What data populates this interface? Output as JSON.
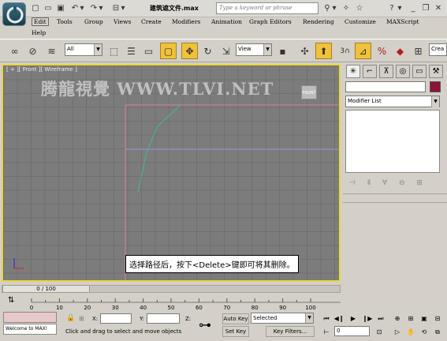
{
  "titlebar": {
    "file_title": "建筑遮文件.max",
    "search_placeholder": "Type a keyword or phrase"
  },
  "menu": [
    "Edit",
    "Tools",
    "Group",
    "Views",
    "Create",
    "Modifiers",
    "Animation",
    "Graph Editors",
    "Rendering",
    "Customize",
    "MAXScript",
    "Help"
  ],
  "toolbar": {
    "selection_filter": "All",
    "coord_system": "View",
    "snap_label": "3",
    "named_set_placeholder": "Crea"
  },
  "viewport": {
    "label": "[ + ][ Front ][ Wireframe ]",
    "watermark": "腾龍視覺 WWW.TLVI.NET",
    "front_gizmo": "FRONT",
    "caption": "选择路径后，按下<Delete>键即可将其删除。"
  },
  "command_panel": {
    "modifier_list": "Modifier List",
    "object_color": "#8b1538"
  },
  "timeline": {
    "frame_readout": "0 / 100",
    "ticks": [
      "0",
      "10",
      "20",
      "30",
      "40",
      "50",
      "60",
      "70",
      "80",
      "90",
      "100"
    ]
  },
  "status": {
    "maxscript_listener": "Welcome to MAX!",
    "x_label": "X:",
    "y_label": "Y:",
    "z_label": "Z:",
    "prompt": "Click and drag to select and move objects",
    "auto_key": "Auto Key",
    "set_key": "Set Key",
    "key_mode": "Selected",
    "key_filters": "Key Filters...",
    "current_frame": "0"
  }
}
